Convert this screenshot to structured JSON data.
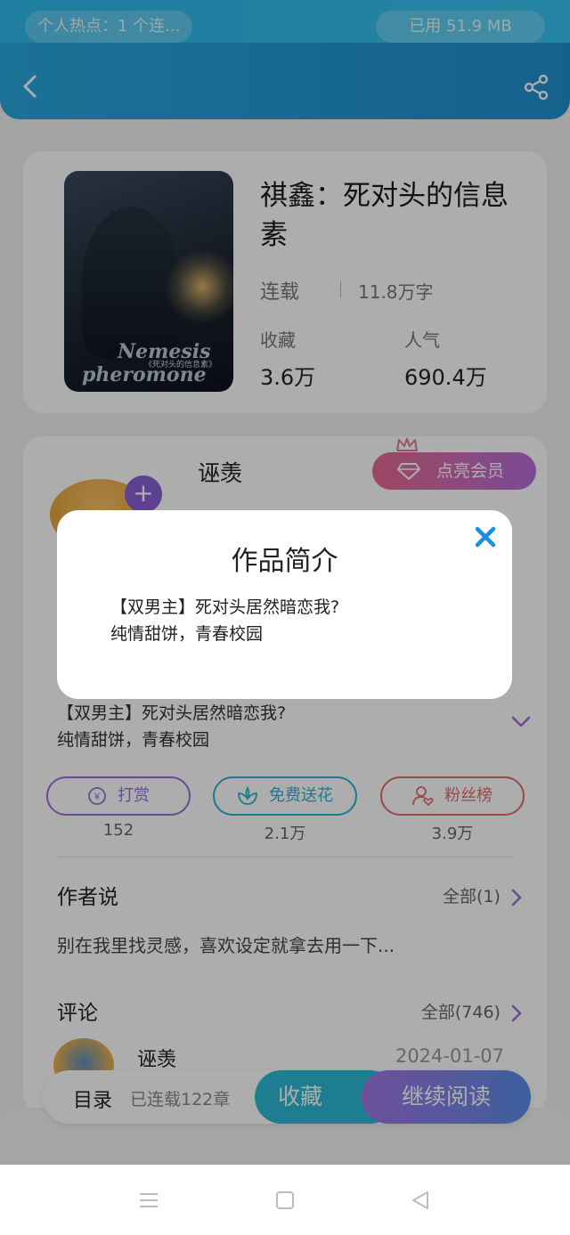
{
  "status_bar": {
    "hotspot_text": "个人热点：1 个连...",
    "data_used": "已用 51.9 MB"
  },
  "header": {
    "back_icon": "chevron-left-icon",
    "share_icon": "share-icon"
  },
  "book": {
    "title": "祺鑫：死对头的信息素",
    "cover_title_line1": "Nemesis",
    "cover_title_line2": "《死对头的信息素》",
    "cover_title_line3": "pheromone",
    "status": "连载",
    "word_count": "11.8万字",
    "favorites_label": "收藏",
    "favorites_value": "3.6万",
    "popularity_label": "人气",
    "popularity_value": "690.4万"
  },
  "author": {
    "name": "诬羡",
    "vip_button": "点亮会员"
  },
  "intro": {
    "line1": "【双男主】死对头居然暗恋我?",
    "line2": "纯情甜饼，青春校园"
  },
  "actions": [
    {
      "label": "打赏",
      "count": "152",
      "color": "#9b6fd6"
    },
    {
      "label": "免费送花",
      "count": "2.1万",
      "color": "#2cb3d4"
    },
    {
      "label": "粉丝榜",
      "count": "3.9万",
      "color": "#e36a6a"
    }
  ],
  "author_says": {
    "title": "作者说",
    "more": "全部(1)",
    "text": "别在我里找灵感，喜欢设定就拿去用一下..."
  },
  "comments": {
    "title": "评论",
    "more": "全部(746)",
    "first_author": "诬羡",
    "first_date": "2024-01-07"
  },
  "bottom_bar": {
    "toc": "目录",
    "chapters": "已连载122章",
    "favorite": "收藏",
    "continue_reading": "继续阅读"
  },
  "modal": {
    "title": "作品简介",
    "line1": "【双男主】死对头居然暗恋我?",
    "line2": "纯情甜饼，青春校园"
  },
  "colors": {
    "header": "#1e90d0",
    "accent_purple": "#9b6fd6",
    "accent_blue": "#2fb8d8",
    "close_x": "#1a8fe0"
  }
}
